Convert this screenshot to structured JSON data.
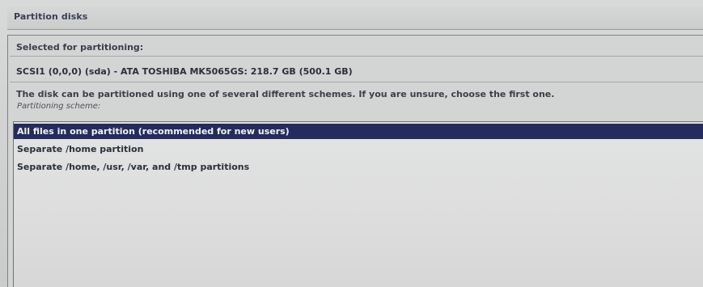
{
  "window": {
    "title": "Partition disks"
  },
  "content": {
    "selected_label": "Selected for partitioning:",
    "disk": "SCSI1 (0,0,0) (sda) - ATA TOSHIBA MK5065GS: 218.7 GB (500.1 GB)",
    "description": "The disk can be partitioned using one of several different schemes. If you are unsure, choose the first one.",
    "scheme_label": "Partitioning scheme:"
  },
  "scheme_list": {
    "items": [
      {
        "label": "All files in one partition (recommended for new users)",
        "selected": true
      },
      {
        "label": "Separate /home partition",
        "selected": false
      },
      {
        "label": "Separate /home, /usr, /var, and /tmp partitions",
        "selected": false
      }
    ]
  },
  "colors": {
    "selection_bg": "#232c5c",
    "selection_text": "#f2f3f7",
    "window_bg": "#d3d4d4",
    "text": "#2c2f38"
  }
}
